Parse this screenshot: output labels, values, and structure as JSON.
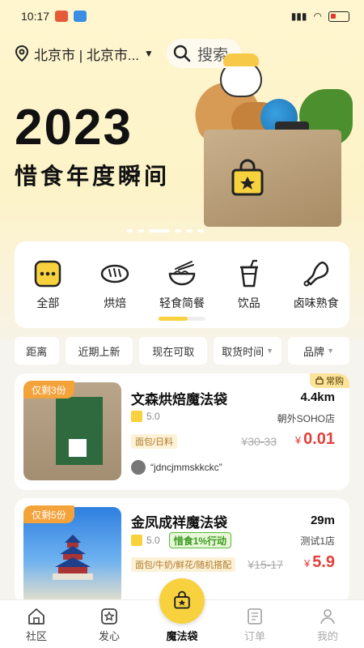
{
  "status_bar": {
    "time": "10:17"
  },
  "header": {
    "location": "北京市 | 北京市...",
    "search_label": "搜索"
  },
  "banner": {
    "year": "2023",
    "subtitle": "惜食年度瞬间",
    "slide_count": 6,
    "active_slide": 2
  },
  "categories": [
    {
      "label": "全部",
      "icon": "all-icon"
    },
    {
      "label": "烘焙",
      "icon": "bread-icon"
    },
    {
      "label": "轻食简餐",
      "icon": "bowl-icon"
    },
    {
      "label": "饮品",
      "icon": "drink-icon"
    },
    {
      "label": "卤味熟食",
      "icon": "drumstick-icon"
    }
  ],
  "filters": {
    "distance": "距离",
    "expiring": "近期上新",
    "available_now": "现在可取",
    "pickup_time": "取货时间",
    "brand": "品牌"
  },
  "listings": [
    {
      "stock": "仅剩3份",
      "regular_tag": "常购",
      "name": "文森烘焙魔法袋",
      "distance": "4.4km",
      "rating": "5.0",
      "store": "朝外SOHO店",
      "tags": [
        "面包/日料"
      ],
      "original_price": "¥30-33",
      "price_currency": "¥",
      "price": "0.01",
      "buyer": "“jdncjmmskkckc”"
    },
    {
      "stock": "仅剩5份",
      "name": "金凤成祥魔法袋",
      "distance": "29m",
      "rating": "5.0",
      "promo": "惜食1%行动",
      "store": "测试1店",
      "tags": [
        "面包/牛奶/鲜花/随机搭配"
      ],
      "original_price": "¥15-17",
      "price_currency": "¥",
      "price": "5.9"
    }
  ],
  "tabbar": {
    "community": "社区",
    "heart": "发心",
    "magic_bag": "魔法袋",
    "orders": "订单",
    "mine": "我的"
  },
  "colors": {
    "accent": "#f7d23e",
    "price": "#e2403a",
    "stock_badge": "#f4a23a"
  }
}
